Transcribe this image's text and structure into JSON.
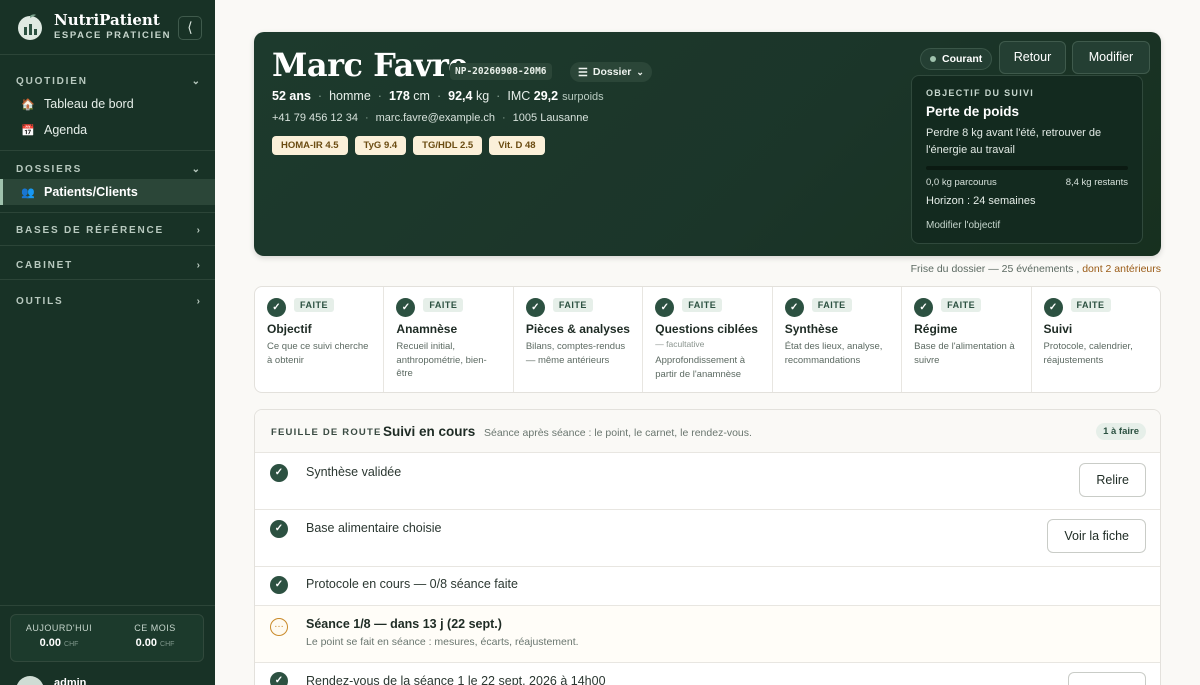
{
  "sidebar": {
    "brand_name": "NutriPatient",
    "brand_sub": "ESPACE PRATICIEN",
    "collapse_label": "⟨",
    "sections": {
      "quotidien": "QUOTIDIEN",
      "dossiers": "DOSSIERS",
      "bases": "BASES DE RÉFÉRENCE",
      "cabinet": "CABINET",
      "outils": "OUTILS"
    },
    "items": {
      "tableau": "Tableau de bord",
      "agenda": "Agenda",
      "patients": "Patients/Clients"
    },
    "stats": {
      "today_label": "AUJOURD'HUI",
      "today_value": "0.00",
      "month_label": "CE MOIS",
      "month_value": "0.00",
      "currency": "CHF"
    },
    "user_name": "admin"
  },
  "patient": {
    "name": "Marc Favre",
    "id": "NP-20260908-20M6",
    "dossier_label": "Dossier",
    "age": "52 ans",
    "sex": "homme",
    "height_value": "178",
    "height_unit": "cm",
    "weight_value": "92,4",
    "weight_unit": "kg",
    "bmi_label": "IMC",
    "bmi_value": "29,2",
    "bmi_class": "surpoids",
    "phone": "+41 79 456 12 34",
    "email": "marc.favre@example.ch",
    "city": "1005 Lausanne",
    "badges": [
      "HOMA-IR 4.5",
      "TyG 9.4",
      "TG/HDL 2.5",
      "Vit. D 48"
    ]
  },
  "header_actions": {
    "status": "Courant",
    "back": "Retour",
    "edit": "Modifier"
  },
  "goal": {
    "kicker": "OBJECTIF DU SUIVI",
    "title": "Perte de poids",
    "description": "Perdre 8 kg avant l'été, retrouver de l'énergie au travail",
    "progress_fraction": 0.0,
    "done": "0,0 kg parcourus",
    "remaining": "8,4 kg restants",
    "horizon": "Horizon : 24 semaines",
    "edit_link": "Modifier l'objectif"
  },
  "frise": {
    "text": "Frise du dossier — 25 événements ,",
    "link": "dont 2 antérieurs"
  },
  "steps": [
    {
      "badge": "FAITE",
      "title": "Objectif",
      "desc": "Ce que ce suivi cherche à obtenir"
    },
    {
      "badge": "FAITE",
      "title": "Anamnèse",
      "desc": "Recueil initial, anthropométrie, bien-être"
    },
    {
      "badge": "FAITE",
      "title": "Pièces & analyses",
      "desc": "Bilans, comptes-rendus — même antérieurs"
    },
    {
      "badge": "FAITE",
      "title": "Questions ciblées",
      "optional": "— facultative",
      "desc": "Approfondissement à partir de l'anamnèse"
    },
    {
      "badge": "FAITE",
      "title": "Synthèse",
      "desc": "État des lieux, analyse, recommandations"
    },
    {
      "badge": "FAITE",
      "title": "Régime",
      "desc": "Base de l'alimentation à suivre"
    },
    {
      "badge": "FAITE",
      "title": "Suivi",
      "desc": "Protocole, calendrier, réajustements"
    }
  ],
  "roadmap": {
    "kicker": "FEUILLE DE ROUTE",
    "title": "Suivi en cours",
    "subtitle": "Séance après séance : le point, le carnet, le rendez-vous.",
    "count": "1 à faire",
    "rows": [
      {
        "text": "Synthèse validée",
        "button": "Relire"
      },
      {
        "text": "Base alimentaire choisie",
        "button": "Voir la fiche"
      },
      {
        "text": "Protocole en cours — 0/8 séance faite"
      },
      {
        "text": "Séance 1/8 — dans 13 j (22 sept.)",
        "sub": "Le point se fait en séance : mesures, écarts, réajustement.",
        "icon": "…"
      },
      {
        "text": "Rendez-vous de la séance 1 le 22 sept. 2026 à 14h00"
      }
    ]
  },
  "colors": {
    "sidebar_bg": "#183226",
    "hero_bg": "#1d3a2d",
    "accent": "#2c5141",
    "badge_bg": "#fbf0d9",
    "link": "#9a5b16"
  }
}
